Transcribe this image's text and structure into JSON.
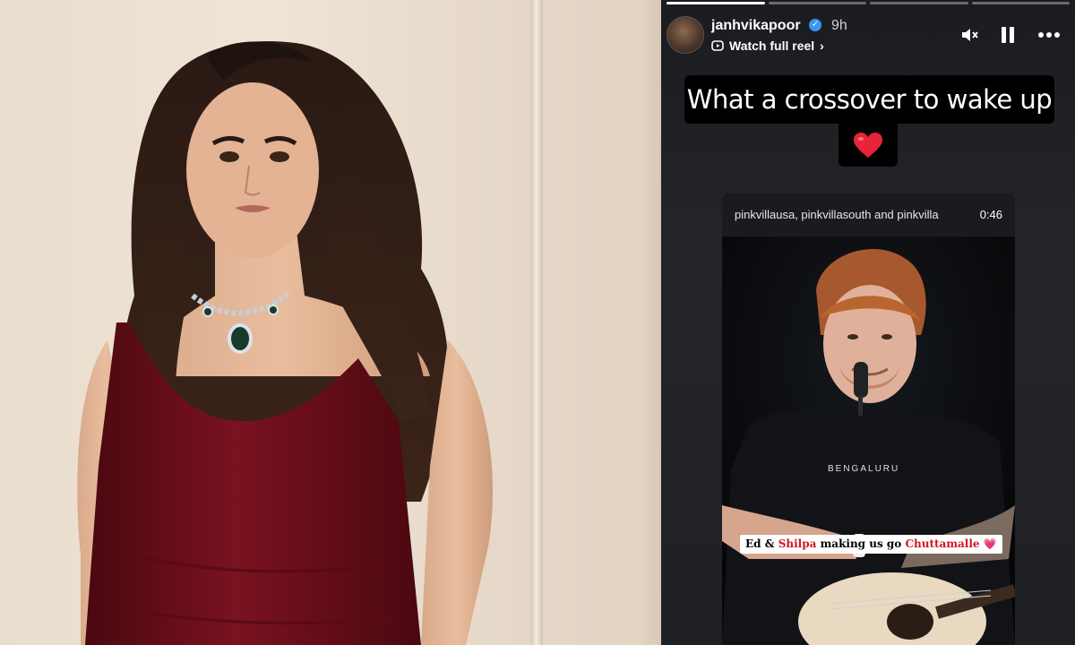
{
  "story": {
    "username": "janhvikapoor",
    "time_ago": "9h",
    "reel_link_label": "Watch full reel",
    "caption_line": "What a crossover to wake up to",
    "heart_emoji": "❤️",
    "progress_segments": 4,
    "active_segment": 1,
    "controls": [
      "mute-icon",
      "pause-icon",
      "more-options-icon"
    ]
  },
  "reel": {
    "credit": "pinkvillausa, pinkvillasouth and pinkvilla",
    "duration": "0:46",
    "shirt_text": "BENGALURU",
    "subtitle": {
      "part1": "Ed & ",
      "part2": "Shilpa",
      "part3": " making us go ",
      "part4": "Chuttamalle",
      "emoji": "💗"
    }
  },
  "colors": {
    "story_bg": "#1e2023",
    "caption_bg": "#000000",
    "subtitle_accent": "#d0181f",
    "verified": "#3897f0",
    "dress": "#6e0e18"
  }
}
